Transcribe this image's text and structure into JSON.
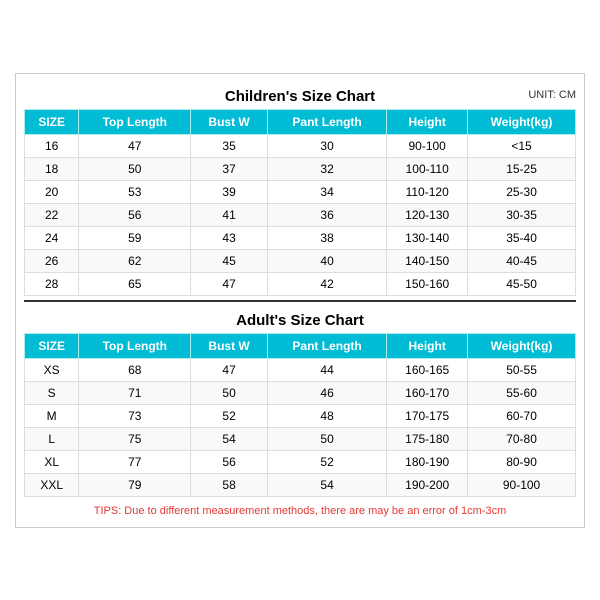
{
  "page": {
    "children_title": "Children's Size Chart",
    "adult_title": "Adult's Size Chart",
    "unit": "UNIT: CM",
    "tips": "TIPS: Due to different measurement methods, there are may be an error of 1cm-3cm",
    "headers": [
      "SIZE",
      "Top Length",
      "Bust W",
      "Pant Length",
      "Height",
      "Weight(kg)"
    ],
    "children_rows": [
      [
        "16",
        "47",
        "35",
        "30",
        "90-100",
        "<15"
      ],
      [
        "18",
        "50",
        "37",
        "32",
        "100-110",
        "15-25"
      ],
      [
        "20",
        "53",
        "39",
        "34",
        "110-120",
        "25-30"
      ],
      [
        "22",
        "56",
        "41",
        "36",
        "120-130",
        "30-35"
      ],
      [
        "24",
        "59",
        "43",
        "38",
        "130-140",
        "35-40"
      ],
      [
        "26",
        "62",
        "45",
        "40",
        "140-150",
        "40-45"
      ],
      [
        "28",
        "65",
        "47",
        "42",
        "150-160",
        "45-50"
      ]
    ],
    "adult_rows": [
      [
        "XS",
        "68",
        "47",
        "44",
        "160-165",
        "50-55"
      ],
      [
        "S",
        "71",
        "50",
        "46",
        "160-170",
        "55-60"
      ],
      [
        "M",
        "73",
        "52",
        "48",
        "170-175",
        "60-70"
      ],
      [
        "L",
        "75",
        "54",
        "50",
        "175-180",
        "70-80"
      ],
      [
        "XL",
        "77",
        "56",
        "52",
        "180-190",
        "80-90"
      ],
      [
        "XXL",
        "79",
        "58",
        "54",
        "190-200",
        "90-100"
      ]
    ]
  }
}
